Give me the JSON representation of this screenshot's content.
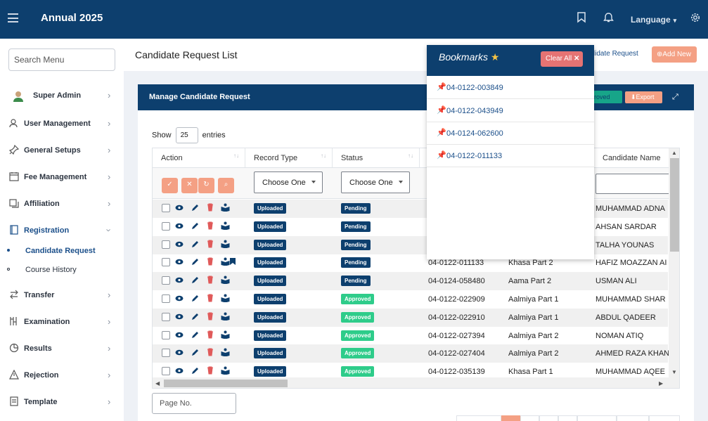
{
  "app": {
    "title": "Annual 2025",
    "language_label": "Language"
  },
  "sidebar": {
    "search_placeholder": "Search Menu",
    "items": [
      {
        "label": "Super Admin",
        "icon": "avatar-icon"
      },
      {
        "label": "User Management",
        "icon": "users-icon"
      },
      {
        "label": "General Setups",
        "icon": "pin-icon"
      },
      {
        "label": "Fee Management",
        "icon": "calendar-icon"
      },
      {
        "label": "Affiliation",
        "icon": "copy-icon"
      },
      {
        "label": "Registration",
        "icon": "book-icon"
      },
      {
        "label": "Transfer",
        "icon": "transfer-icon"
      },
      {
        "label": "Examination",
        "icon": "exam-icon"
      },
      {
        "label": "Results",
        "icon": "pie-icon"
      },
      {
        "label": "Rejection",
        "icon": "warning-icon"
      },
      {
        "label": "Template",
        "icon": "template-icon"
      }
    ],
    "sub_items": [
      {
        "label": "Candidate Request"
      },
      {
        "label": "Course History"
      }
    ]
  },
  "header": {
    "page_title": "Candidate Request List",
    "link_text": "ndidate Request",
    "add_new_label": "Add New"
  },
  "card": {
    "title": "Manage Candidate Request",
    "approved_label": "proved",
    "export_label": "Export",
    "show_label": "Show",
    "entries_value": "25",
    "entries_label": "entries"
  },
  "table": {
    "columns": [
      "Action",
      "Record Type",
      "Status",
      "Candidate Name"
    ],
    "filter_record_type": "Choose One",
    "filter_status": "Choose One",
    "rows": [
      {
        "record_type": "Uploaded",
        "status": "Pending",
        "reg_no": "",
        "course": "",
        "name": "MUHAMMAD ADNA",
        "bookmarked": false
      },
      {
        "record_type": "Uploaded",
        "status": "Pending",
        "reg_no": "",
        "course": "",
        "name": "AHSAN SARDAR",
        "bookmarked": false
      },
      {
        "record_type": "Uploaded",
        "status": "Pending",
        "reg_no": "",
        "course": "",
        "name": "TALHA YOUNAS",
        "bookmarked": false
      },
      {
        "record_type": "Uploaded",
        "status": "Pending",
        "reg_no": "04-0122-011133",
        "course": "Khasa Part 2",
        "name": "HAFIZ MOAZZAN AI",
        "bookmarked": true
      },
      {
        "record_type": "Uploaded",
        "status": "Pending",
        "reg_no": "04-0124-058480",
        "course": "Aama Part 2",
        "name": "USMAN ALI",
        "bookmarked": false
      },
      {
        "record_type": "Uploaded",
        "status": "Approved",
        "reg_no": "04-0122-022909",
        "course": "Aalmiya Part 1",
        "name": "MUHAMMAD SHAR",
        "bookmarked": false
      },
      {
        "record_type": "Uploaded",
        "status": "Approved",
        "reg_no": "04-0122-022910",
        "course": "Aalmiya Part 1",
        "name": "ABDUL QADEER",
        "bookmarked": false
      },
      {
        "record_type": "Uploaded",
        "status": "Approved",
        "reg_no": "04-0122-027394",
        "course": "Aalmiya Part 2",
        "name": "NOMAN ATIQ",
        "bookmarked": false
      },
      {
        "record_type": "Uploaded",
        "status": "Approved",
        "reg_no": "04-0122-027404",
        "course": "Aalmiya Part 2",
        "name": "AHMED RAZA KHAN",
        "bookmarked": false
      },
      {
        "record_type": "Uploaded",
        "status": "Approved",
        "reg_no": "04-0122-035139",
        "course": "Khasa Part 1",
        "name": "MUHAMMAD AQEE",
        "bookmarked": false
      }
    ]
  },
  "pagination": {
    "page_no_placeholder": "Page No."
  },
  "bookmarks": {
    "title": "Bookmarks",
    "clear_label": "Clear All",
    "items": [
      "04-0122-003849",
      "04-0122-043949",
      "04-0124-062600",
      "04-0122-011133"
    ]
  },
  "colors": {
    "navy": "#0d3f6e",
    "salmon": "#f4a084",
    "green": "#2ecc8a",
    "danger": "#e57373"
  }
}
